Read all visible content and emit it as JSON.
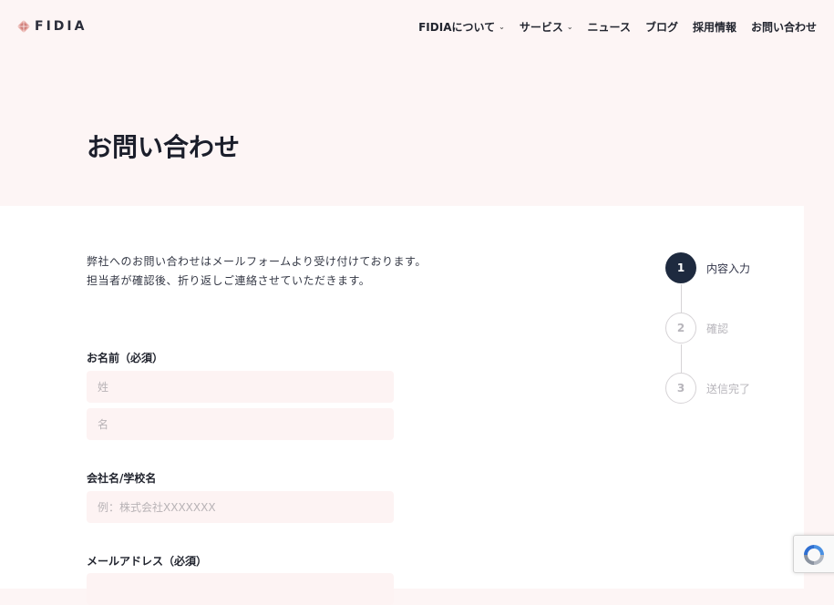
{
  "header": {
    "logo_text": "FIDIA",
    "nav": [
      {
        "label": "FIDIAについて",
        "has_dropdown": true
      },
      {
        "label": "サービス",
        "has_dropdown": true
      },
      {
        "label": "ニュース",
        "has_dropdown": false
      },
      {
        "label": "ブログ",
        "has_dropdown": false
      },
      {
        "label": "採用情報",
        "has_dropdown": false
      },
      {
        "label": "お問い合わせ",
        "has_dropdown": false
      }
    ]
  },
  "page": {
    "title": "お問い合わせ"
  },
  "intro": {
    "line1": "弊社へのお問い合わせはメールフォームより受け付けております。",
    "line2": "担当者が確認後、折り返しご連絡させていただきます。"
  },
  "form": {
    "name_label": "お名前（必須）",
    "last_name_placeholder": "姓",
    "first_name_placeholder": "名",
    "company_label": "会社名/学校名",
    "company_placeholder": "例：株式会社XXXXXXX",
    "email_label": "メールアドレス（必須）"
  },
  "steps": [
    {
      "number": "1",
      "label": "内容入力",
      "active": true
    },
    {
      "number": "2",
      "label": "確認",
      "active": false
    },
    {
      "number": "3",
      "label": "送信完了",
      "active": false
    }
  ],
  "colors": {
    "page_bg": "#fdf5f5",
    "input_bg": "#fdf3f3",
    "active_step": "#1e2a3f",
    "logo_accent": "#d98b8b"
  }
}
